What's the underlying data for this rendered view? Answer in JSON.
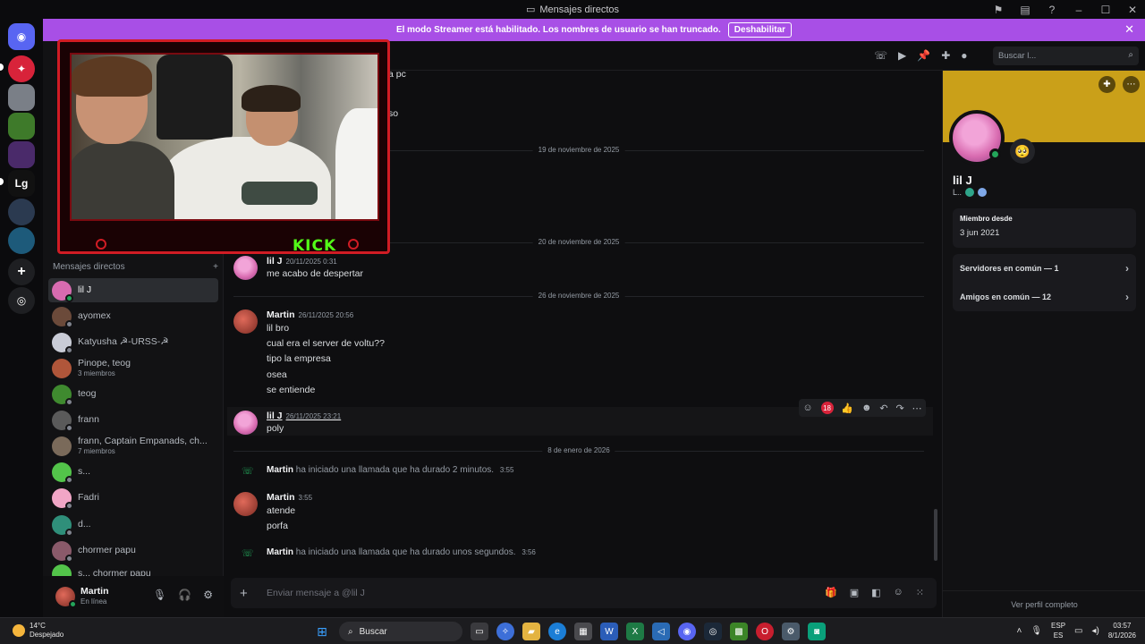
{
  "window": {
    "title": "Mensajes directos"
  },
  "banner": {
    "text": "El modo Streamer está habilitado. Los nombres de usuario se han truncado.",
    "button": "Deshabilitar"
  },
  "rail": {
    "letter_server": "Lg"
  },
  "dm": {
    "header": "Mensajes directos",
    "add": "+",
    "items": [
      {
        "name": "lil J",
        "sub": "",
        "color": "#d86bb0",
        "status": "#23a55a"
      },
      {
        "name": "ayomex",
        "sub": "",
        "color": "#6b4a3a",
        "status": "#80848e"
      },
      {
        "name": "Katyusha ☭-URSS-☭",
        "sub": "",
        "color": "#c9ccd6",
        "status": "#80848e"
      },
      {
        "name": "Pinope, teog",
        "sub": "3 miembros",
        "color": "#b0563a",
        "status": ""
      },
      {
        "name": "teog",
        "sub": "",
        "color": "#3f8a2f",
        "status": "#80848e"
      },
      {
        "name": "frann",
        "sub": "",
        "color": "#5a5a5a",
        "status": "#80848e"
      },
      {
        "name": "frann, Captain Empanads, ch...",
        "sub": "7 miembros",
        "color": "#7a6a5a",
        "status": ""
      },
      {
        "name": "s...",
        "sub": "",
        "color": "#53c44a",
        "status": "#80848e"
      },
      {
        "name": "Fadri",
        "sub": "",
        "color": "#f1a6c6",
        "status": "#80848e"
      },
      {
        "name": "d...",
        "sub": "",
        "color": "#2f8f7a",
        "status": "#80848e"
      },
      {
        "name": "chormer papu",
        "sub": "",
        "color": "#8a5a6a",
        "status": "#80848e"
      },
      {
        "name": "s... chormer papu",
        "sub": "",
        "color": "#53c44a",
        "status": ""
      }
    ]
  },
  "user": {
    "name": "Martin",
    "status": "En línea"
  },
  "chat": {
    "search_placeholder": "Buscar l...",
    "partial_top": [
      "a pc",
      "so"
    ],
    "dividers": [
      "19 de noviembre de 2025",
      "20 de noviembre de 2025",
      "26 de noviembre de 2025",
      "8 de enero de 2026"
    ],
    "messages": [
      {
        "author": "lil J",
        "time": "20/11/2025 0:31",
        "lines": [
          "me acabo de despertar"
        ]
      },
      {
        "author": "Martin",
        "time": "26/11/2025 20:56",
        "lines": [
          "lil bro",
          "cual era el server de voltu??",
          "tipo la empresa",
          "osea",
          "se entiende"
        ]
      },
      {
        "author": "lil J",
        "time": "26/11/2025 23:21",
        "lines": [
          "poly"
        ]
      },
      {
        "author": "Martin",
        "time": "3:55",
        "lines": [
          "atende",
          "porfa"
        ]
      }
    ],
    "calls": [
      {
        "author": "Martin",
        "text": "ha iniciado una llamada que ha durado 2 minutos.",
        "time": "3:55"
      },
      {
        "author": "Martin",
        "text": "ha iniciado una llamada que ha durado unos segundos.",
        "time": "3:56"
      }
    ],
    "reaction_count": "18",
    "composer_placeholder": "Enviar mensaje a @lil J"
  },
  "profile": {
    "name": "lil J",
    "tag": "L..",
    "member_since_label": "Miembro desde",
    "member_since": "3 jun 2021",
    "servers_common": "Servidores en común — 1",
    "friends_common": "Amigos en común — 12",
    "full_profile": "Ver perfil completo"
  },
  "stream": {
    "brand": "KICK"
  },
  "taskbar": {
    "temp": "14°C",
    "weather": "Despejado",
    "search": "Buscar",
    "lang1": "ESP",
    "lang2": "ES",
    "time": "03:57",
    "date": "8/1/2026"
  }
}
